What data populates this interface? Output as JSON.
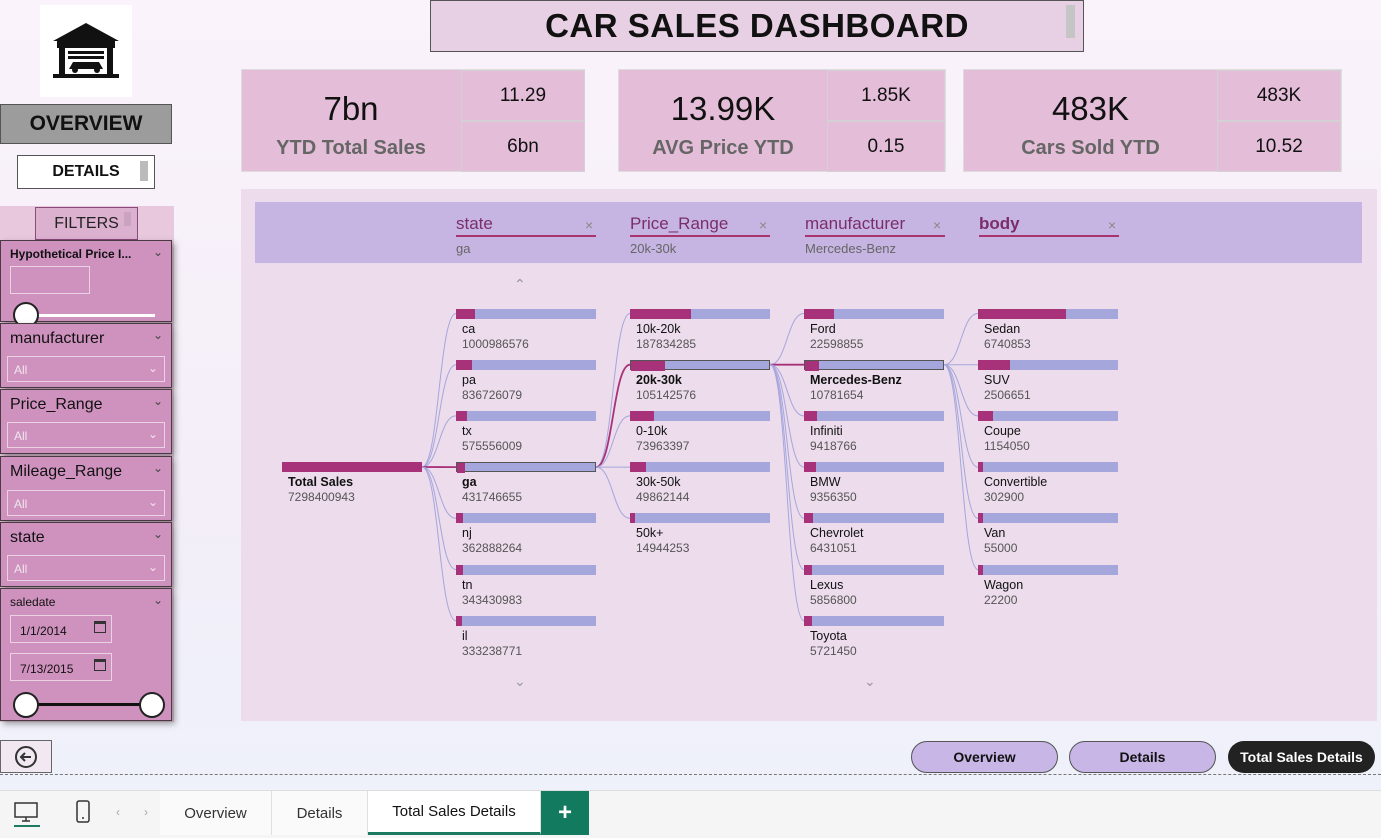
{
  "title": "CAR SALES DASHBOARD",
  "nav": {
    "overview": "OVERVIEW",
    "details": "DETAILS",
    "filters": "FILTERS"
  },
  "slicers": {
    "hyp": {
      "label": "Hypothetical Price I...",
      "value": ""
    },
    "manufacturer": {
      "label": "manufacturer",
      "value": "All"
    },
    "price_range": {
      "label": "Price_Range",
      "value": "All"
    },
    "mileage_range": {
      "label": "Mileage_Range",
      "value": "All"
    },
    "state": {
      "label": "state",
      "value": "All"
    },
    "saledate": {
      "label": "saledate",
      "from": "1/1/2014",
      "to": "7/13/2015"
    }
  },
  "kpis": [
    {
      "main": "7bn",
      "label": "YTD Total Sales",
      "sub1": "11.29",
      "sub2": "6bn"
    },
    {
      "main": "13.99K",
      "label": "AVG Price YTD",
      "sub1": "1.85K",
      "sub2": "0.15"
    },
    {
      "main": "483K",
      "label": "Cars Sold YTD",
      "sub1": "483K",
      "sub2": "10.52"
    }
  ],
  "tree": {
    "columns": [
      {
        "title": "state",
        "filter": "ga"
      },
      {
        "title": "Price_Range",
        "filter": "20k-30k"
      },
      {
        "title": "manufacturer",
        "filter": "Mercedes-Benz"
      },
      {
        "title": "body",
        "filter": ""
      }
    ],
    "root": {
      "name": "Total Sales",
      "value": "7298400943"
    },
    "state": [
      {
        "name": "ca",
        "value": "1000986576",
        "frac": 0.137
      },
      {
        "name": "pa",
        "value": "836726079",
        "frac": 0.115
      },
      {
        "name": "tx",
        "value": "575556009",
        "frac": 0.079
      },
      {
        "name": "ga",
        "value": "431746655",
        "frac": 0.059,
        "selected": true
      },
      {
        "name": "nj",
        "value": "362888264",
        "frac": 0.05
      },
      {
        "name": "tn",
        "value": "343430983",
        "frac": 0.047
      },
      {
        "name": "il",
        "value": "333238771",
        "frac": 0.046
      }
    ],
    "price": [
      {
        "name": "10k-20k",
        "value": "187834285",
        "frac": 0.435
      },
      {
        "name": "20k-30k",
        "value": "105142576",
        "frac": 0.244,
        "selected": true
      },
      {
        "name": "0-10k",
        "value": "73963397",
        "frac": 0.171
      },
      {
        "name": "30k-50k",
        "value": "49862144",
        "frac": 0.115
      },
      {
        "name": "50k+",
        "value": "14944253",
        "frac": 0.035
      }
    ],
    "manufacturer": [
      {
        "name": "Ford",
        "value": "22598855",
        "frac": 0.215
      },
      {
        "name": "Mercedes-Benz",
        "value": "10781654",
        "frac": 0.103,
        "selected": true
      },
      {
        "name": "Infiniti",
        "value": "9418766",
        "frac": 0.09
      },
      {
        "name": "BMW",
        "value": "9356350",
        "frac": 0.089
      },
      {
        "name": "Chevrolet",
        "value": "6431051",
        "frac": 0.061
      },
      {
        "name": "Lexus",
        "value": "5856800",
        "frac": 0.056
      },
      {
        "name": "Toyota",
        "value": "5721450",
        "frac": 0.054
      }
    ],
    "body": [
      {
        "name": "Sedan",
        "value": "6740853",
        "frac": 0.625
      },
      {
        "name": "SUV",
        "value": "2506651",
        "frac": 0.232
      },
      {
        "name": "Coupe",
        "value": "1154050",
        "frac": 0.107
      },
      {
        "name": "Convertible",
        "value": "302900",
        "frac": 0.028
      },
      {
        "name": "Van",
        "value": "55000",
        "frac": 0.005
      },
      {
        "name": "Wagon",
        "value": "22200",
        "frac": 0.002
      }
    ]
  },
  "page_buttons": {
    "overview": "Overview",
    "details": "Details",
    "total": "Total Sales Details"
  },
  "tabs": {
    "overview": "Overview",
    "details": "Details",
    "total": "Total Sales Details",
    "add": "+"
  },
  "colors": {
    "accent": "#a8327a",
    "bar_bg": "#a5a6dc",
    "header": "#c6b5e3",
    "card": "#e4bdd8"
  }
}
